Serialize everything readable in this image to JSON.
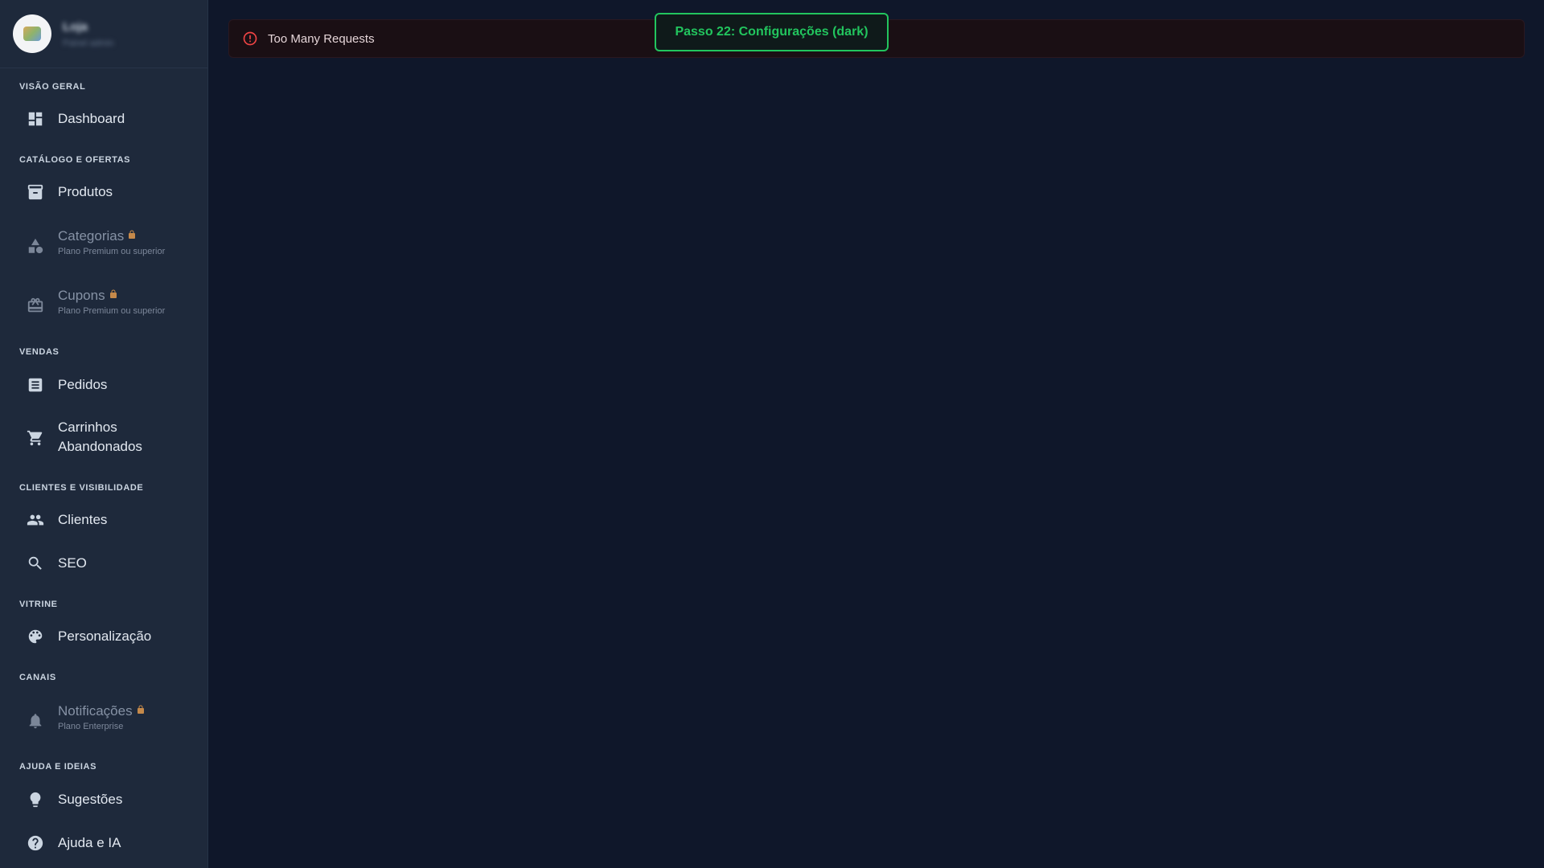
{
  "store": {
    "name": "Loja",
    "subtitle": "Painel admin"
  },
  "sections": {
    "overview": "VISÃO GERAL",
    "catalog": "CATÁLOGO E OFERTAS",
    "sales": "VENDAS",
    "clients": "CLIENTES E VISIBILIDADE",
    "storefront": "VITRINE",
    "channels": "CANAIS",
    "help": "AJUDA E IDEIAS"
  },
  "nav": {
    "dashboard": "Dashboard",
    "products": "Produtos",
    "categories": {
      "label": "Categorias",
      "note": "Plano Premium ou superior"
    },
    "coupons": {
      "label": "Cupons",
      "note": "Plano Premium ou superior"
    },
    "orders": "Pedidos",
    "abandoned_carts_line1": "Carrinhos",
    "abandoned_carts_line2": "Abandonados",
    "customers": "Clientes",
    "seo": "SEO",
    "customization": "Personalização",
    "notifications": {
      "label": "Notificações",
      "note": "Plano Enterprise"
    },
    "suggestions": "Sugestões",
    "help_ai": "Ajuda e IA"
  },
  "error": {
    "message": "Too Many Requests",
    "icon": "error-circle-icon",
    "color": "#ef4444"
  },
  "step_badge": {
    "text": "Passo 22: Configurações (dark)",
    "color": "#22c55e"
  },
  "colors": {
    "background": "#0f172a",
    "sidebar": "#1e293b",
    "lock": "#c5894a"
  }
}
